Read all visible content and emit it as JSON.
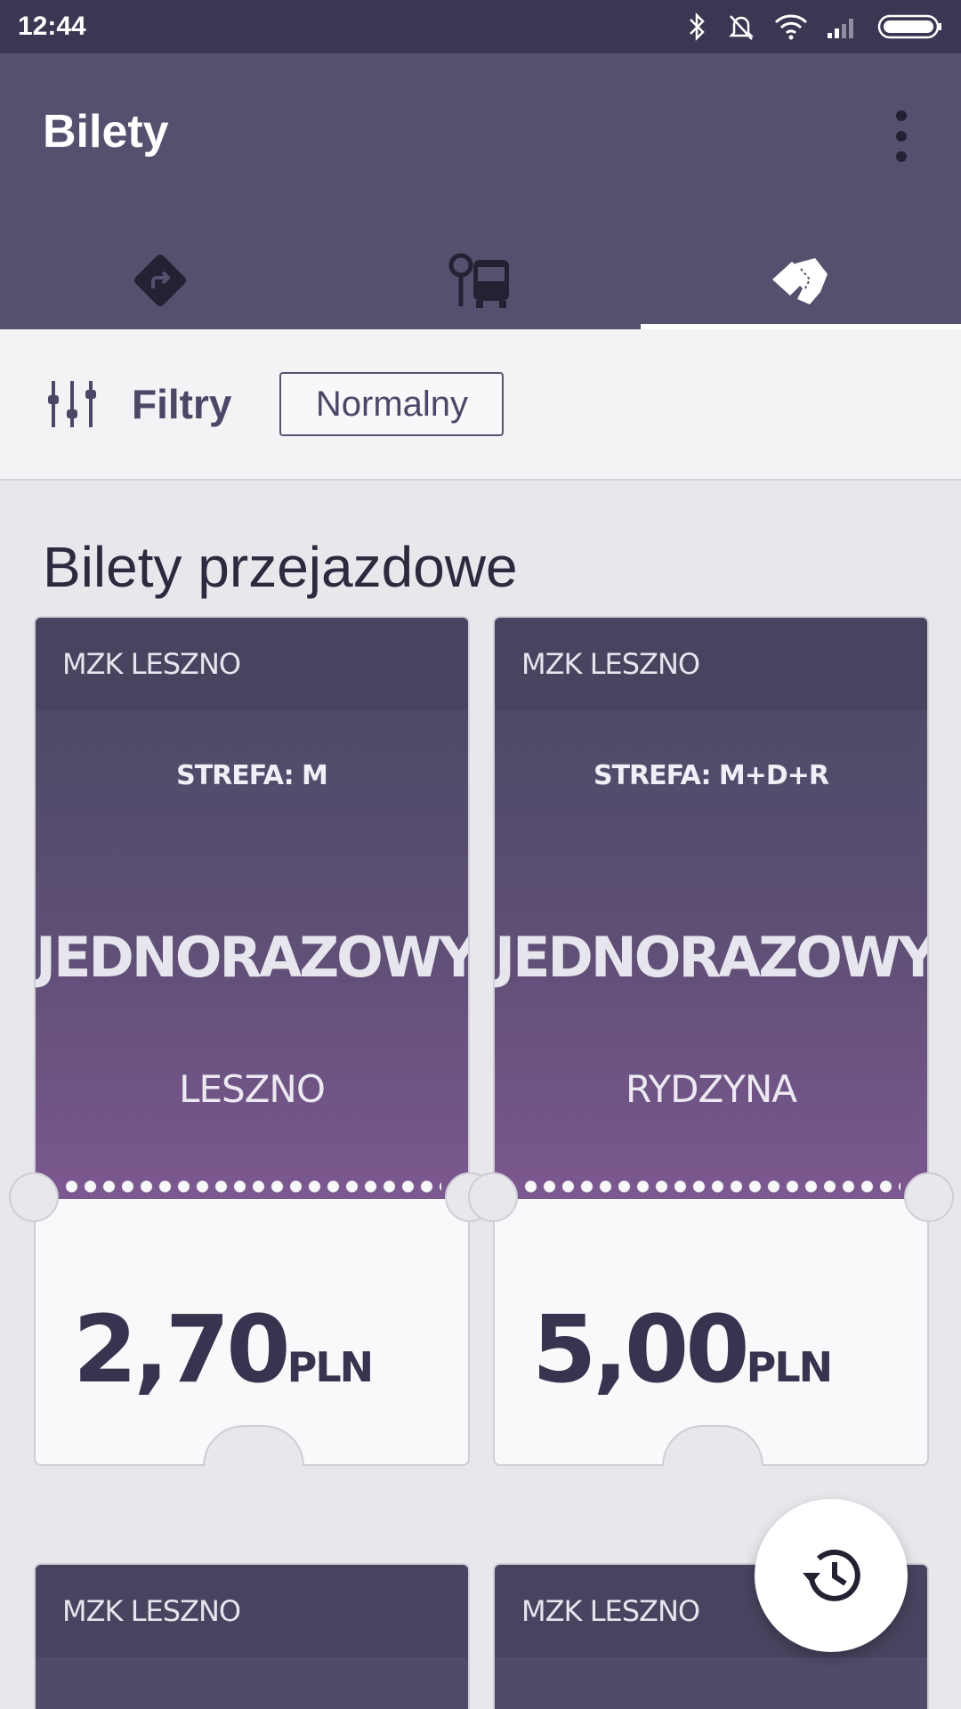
{
  "status_bar": {
    "time": "12:44"
  },
  "app_bar": {
    "title": "Bilety"
  },
  "tabs": [
    {
      "icon": "directions-icon",
      "active": false
    },
    {
      "icon": "bus-stop-icon",
      "active": false
    },
    {
      "icon": "tickets-icon",
      "active": true
    }
  ],
  "filters": {
    "label": "Filtry",
    "chip": "Normalny"
  },
  "section_title": "Bilety przejazdowe",
  "tickets": [
    {
      "operator": "MZK LESZNO",
      "zone": "STREFA: M",
      "type": "JEDNORAZOWY",
      "place": "LESZNO",
      "price": "2,70",
      "currency": "PLN"
    },
    {
      "operator": "MZK LESZNO",
      "zone": "STREFA: M+D+R",
      "type": "JEDNORAZOWY",
      "place": "RYDZYNA",
      "price": "5,00",
      "currency": "PLN"
    },
    {
      "operator": "MZK LESZNO"
    },
    {
      "operator": "MZK LESZNO"
    }
  ],
  "fab": {
    "icon": "history-icon"
  }
}
